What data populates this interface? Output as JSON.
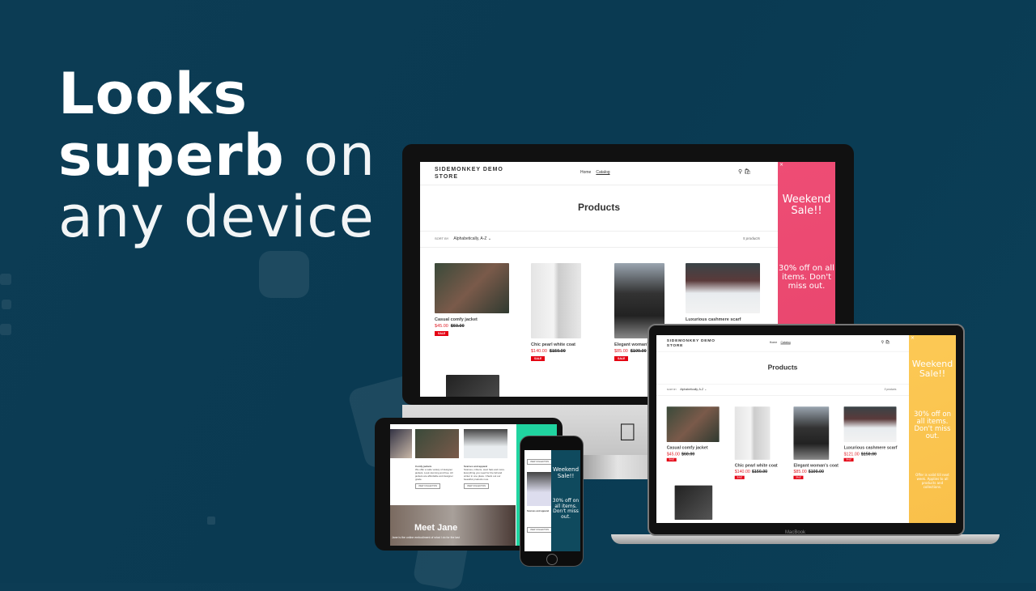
{
  "headline": {
    "line1": "Looks",
    "line2_bold": "superb",
    "line2_light": "on",
    "line3": "any device"
  },
  "store": {
    "title": "SIDEMONKEY DEMO STORE",
    "nav": [
      "Home",
      "Catalog"
    ],
    "heading": "Products",
    "sort_label": "SORT BY",
    "sort_value": "Alphabetically, A-Z",
    "count": "5 products",
    "sale_badge": "SALE",
    "products": [
      {
        "name": "Casual comfy jacket",
        "price": "$45.00",
        "old_price": "$60.00"
      },
      {
        "name": "Chic pearl white coat",
        "price": "$140.00",
        "old_price": "$150.00"
      },
      {
        "name": "Elegant woman's coat",
        "price": "$85.00",
        "old_price": "$100.00"
      },
      {
        "name": "Luxurious cashmere scarf",
        "price": "$121.00",
        "old_price": "$150.00"
      }
    ]
  },
  "popup": {
    "title": "Weekend Sale!!",
    "message": "30% off on all items. Don't miss out.",
    "fine_print": "Offer is valid till next week. Applies to all products and collections.",
    "close": "×"
  },
  "colors": {
    "background": "#0b3c54",
    "monitor_popup": "#ec4a72",
    "laptop_popup": "#fbc54f",
    "tablet_popup": "#20d4a0",
    "phone_popup": "#0f4a5e",
    "sale_red": "#e40012"
  },
  "tablet": {
    "collections": [
      {
        "title": "Comfy jackets",
        "text": "We offer a wide variety of designer jackets. Look stunning and free. All jackets are affordable and designer grade."
      },
      {
        "title": "Scarves and apparel",
        "text": "Scarves, mittens, wool hats and more. Everything you need for the fall and winter in one place. Check out our beautiful products now."
      }
    ],
    "button": "VIEW COLLECTION",
    "hero": "Meet Jane",
    "hero_sub": "Jane is the online embodiment of what I do for the last"
  },
  "laptop": {
    "brand": "MacBook"
  },
  "phone": {
    "collection_title": "Scarves and apparel"
  }
}
